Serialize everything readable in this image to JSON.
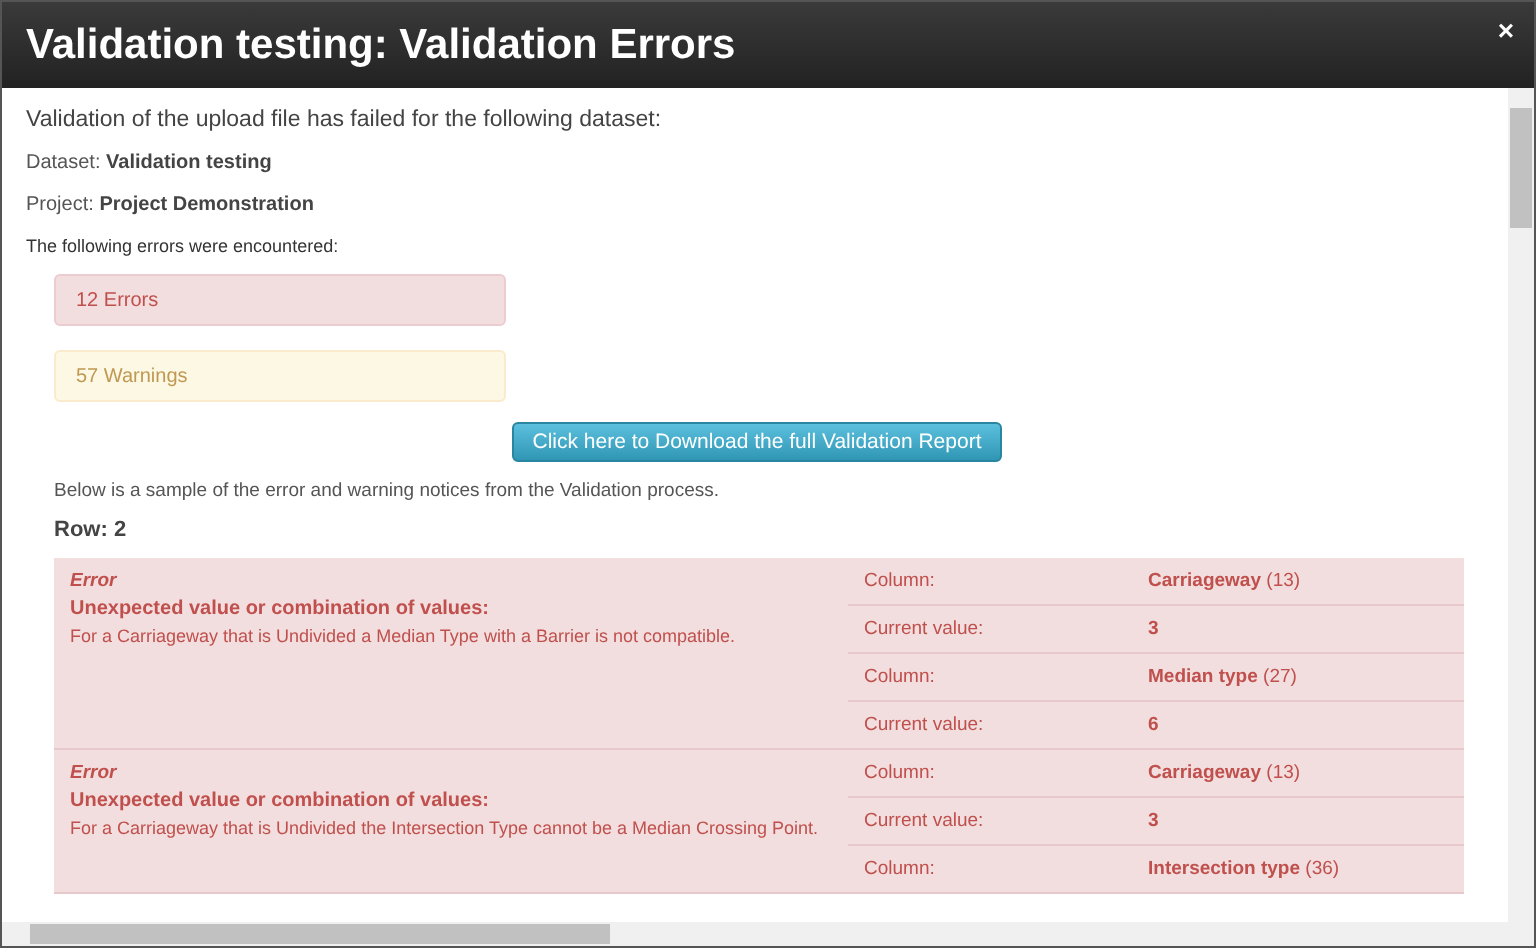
{
  "window": {
    "title": "Validation testing: Validation Errors",
    "close": "×"
  },
  "intro": "Validation of the upload file has failed for the following dataset:",
  "dataset": {
    "label": "Dataset:",
    "value": "Validation testing"
  },
  "project": {
    "label": "Project:",
    "value": "Project Demonstration"
  },
  "errors_heading": "The following errors were encountered:",
  "alerts": [
    {
      "kind": "error",
      "text": "12 Errors"
    },
    {
      "kind": "warning",
      "text": "57 Warnings"
    }
  ],
  "download_button": "Click here to Download the full Validation Report",
  "sample_note": "Below is a sample of the error and warning notices from the Validation process.",
  "row": {
    "label": "Row:",
    "value": "2"
  },
  "notices": [
    {
      "kind": "error",
      "severity": "Error",
      "title": "Unexpected value or combination of values:",
      "message": "For a Carriageway that is Undivided a Median Type with a Barrier is not compatible.",
      "details": [
        {
          "label": "Column:",
          "value": "**Carriageway** (13)"
        },
        {
          "label": "Current value:",
          "value": "**3**"
        },
        {
          "label": "Column:",
          "value": "**Median type** (27)"
        },
        {
          "label": "Current value:",
          "value": "**6**"
        }
      ]
    },
    {
      "kind": "error",
      "severity": "Error",
      "title": "Unexpected value or combination of values:",
      "message": "For a Carriageway that is Undivided the Intersection Type cannot be a Median Crossing Point.",
      "details": [
        {
          "label": "Column:",
          "value": "**Carriageway** (13)"
        },
        {
          "label": "Current value:",
          "value": "**3**"
        },
        {
          "label": "Column:",
          "value": "**Intersection type** (36)"
        }
      ]
    }
  ]
}
